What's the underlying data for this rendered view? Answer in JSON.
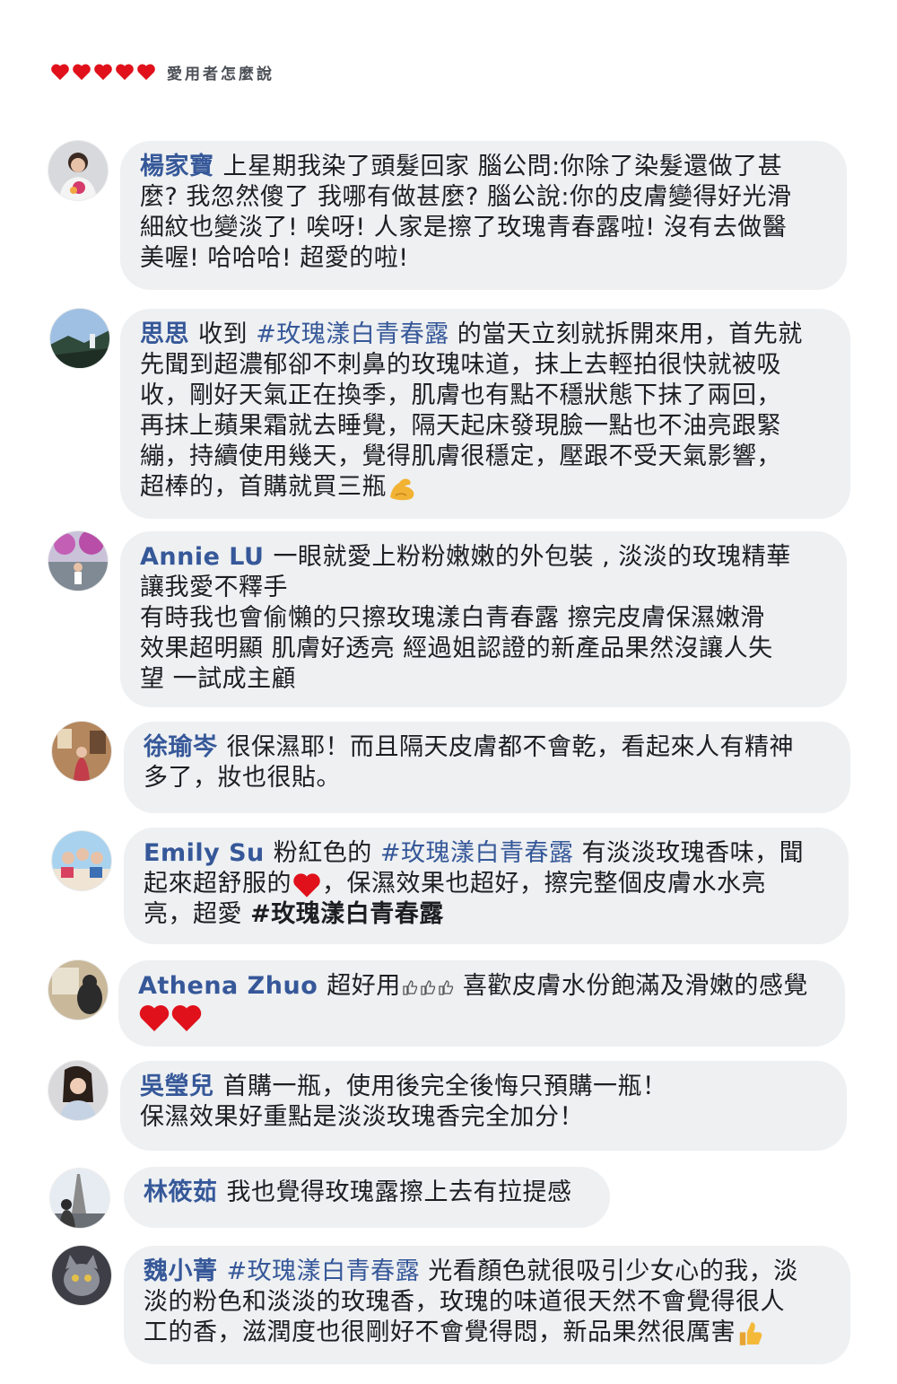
{
  "header": {
    "title": "愛用者怎麼說",
    "heart_color": "#e0111b",
    "heart_count": 5
  },
  "colors": {
    "name": "#365899",
    "bubble": "#eef0f2",
    "text": "#1c1e21"
  },
  "comments": [
    {
      "name": "楊家寶",
      "lines": [
        "上星期我染了頭髮回家 腦公問:你除了染髮還做了甚",
        "麼? 我忽然傻了 我哪有做甚麼? 腦公說:你的皮膚變得好光滑",
        "細紋也變淡了! 唉呀! 人家是擦了玫瑰青春露啦! 沒有去做醫",
        "美喔! 哈哈哈! 超愛的啦!"
      ]
    },
    {
      "name": "思思",
      "pre": "收到 ",
      "tag": "#玫瑰漾白青春露",
      "post": " 的當天立刻就拆開來用，首先就",
      "lines": [
        "先聞到超濃郁卻不刺鼻的玫瑰味道，抹上去輕拍很快就被吸",
        "收，剛好天氣正在換季，肌膚也有點不穩狀態下抹了兩回，",
        "再抹上蘋果霜就去睡覺，隔天起床發現臉一點也不油亮跟緊",
        "繃，持續使用幾天，覺得肌膚很穩定，壓跟不受天氣影響，",
        "超棒的，首購就買三瓶"
      ],
      "emoji": "flexed-biceps-icon"
    },
    {
      "name": "Annie LU",
      "lines": [
        "一眼就愛上粉粉嫩嫩的外包裝 , 淡淡的玫瑰精華",
        "讓我愛不釋手",
        "有時我也會偷懶的只擦玫瑰漾白青春露 擦完皮膚保濕嫩滑",
        "效果超明顯 肌膚好透亮 經過姐認證的新產品果然沒讓人失",
        "望 一試成主顧"
      ]
    },
    {
      "name": "徐瑜岑",
      "lines": [
        "很保濕耶！而且隔天皮膚都不會乾，看起來人有精神",
        "多了，妝也很貼。"
      ]
    },
    {
      "name": "Emily Su",
      "pre": "粉紅色的 ",
      "tag": "#玫瑰漾白青春露",
      "post": " 有淡淡玫瑰香味，聞",
      "line2a": "起來超舒服的",
      "line2b": "，保濕效果也超好，擦完整個皮膚水水亮",
      "line3a": "亮，超愛 ",
      "line3tag": "#玫瑰漾白青春露"
    },
    {
      "name": "Athena Zhuo",
      "pre": "超好用",
      "post": " 喜歡皮膚水份飽滿及滑嫩的感覺"
    },
    {
      "name": "吳瑩兒",
      "lines": [
        "首購一瓶，使用後完全後悔只預購一瓶！",
        "保濕效果好重點是淡淡玫瑰香完全加分！"
      ]
    },
    {
      "name": "林筱茹",
      "lines": [
        "我也覺得玫瑰露擦上去有拉提感"
      ]
    },
    {
      "name": "魏小菁",
      "tag": "#玫瑰漾白青春露",
      "post": " 光看顏色就很吸引少女心的我，淡",
      "lines": [
        "淡的粉色和淡淡的玫瑰香，玫瑰的味道很天然不會覺得很人",
        "工的香，滋潤度也很剛好不會覺得悶，新品果然很厲害"
      ],
      "emoji": "thumbs-up-icon"
    }
  ]
}
